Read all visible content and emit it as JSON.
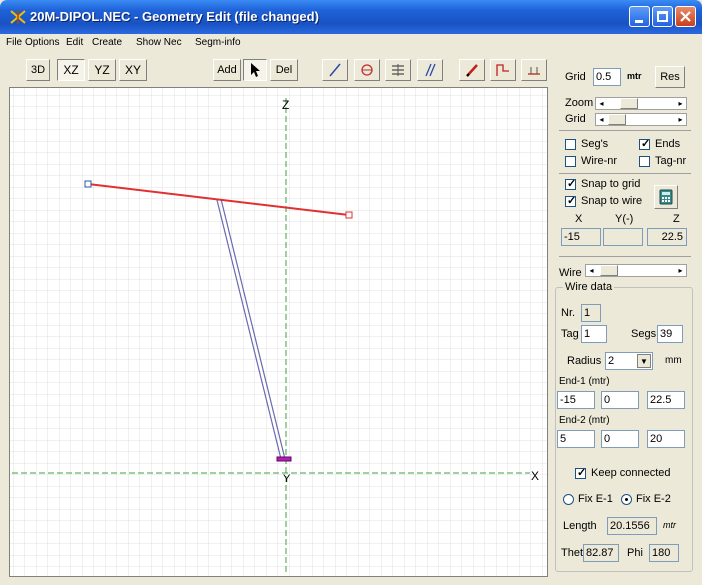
{
  "window": {
    "title": "20M-DIPOL.NEC - Geometry Edit (file changed)"
  },
  "menu": [
    "File",
    "Options",
    "Edit",
    "Create",
    "Show Nec",
    "Segm-info"
  ],
  "toolbar": {
    "view_3d": "3D",
    "view_xz": "XZ",
    "view_yz": "YZ",
    "view_xy": "XY",
    "add": "Add",
    "del": "Del"
  },
  "canvas": {
    "axis_z": "Z",
    "axis_x": "X",
    "axis_y": "Y"
  },
  "panel": {
    "grid_label": "Grid",
    "grid_value": "0.5",
    "grid_unit": "mtr",
    "res_button": "Res",
    "zoom_label": "Zoom",
    "grid_slider_label": "Grid",
    "segs_label": "Seg's",
    "ends_label": "Ends",
    "wirenr_label": "Wire-nr",
    "tagnr_label": "Tag-nr",
    "snap_grid_label": "Snap to grid",
    "snap_wire_label": "Snap to wire",
    "x_label": "X",
    "y_label": "Y(-)",
    "z_label": "Z",
    "x_value": "-15",
    "y_value": "",
    "z_value": "22.5",
    "wire_label": "Wire",
    "wire_data_label": "Wire data",
    "nr_label": "Nr.",
    "nr_value": "1",
    "tag_label": "Tag",
    "tag_value": "1",
    "segs_count_label": "Segs",
    "segs_value": "39",
    "radius_label": "Radius",
    "radius_value": "2",
    "radius_unit": "mm",
    "end1_label": "End-1 (mtr)",
    "end1": [
      "-15",
      "0",
      "22.5"
    ],
    "end2_label": "End-2 (mtr)",
    "end2": [
      "5",
      "0",
      "20"
    ],
    "keep_connected_label": "Keep connected",
    "fix_e1_label": "Fix E-1",
    "fix_e2_label": "Fix E-2",
    "length_label": "Length",
    "length_value": "20.1556",
    "length_unit": "mtr",
    "theta_label": "Thet",
    "theta_value": "82.87",
    "phi_label": "Phi",
    "phi_value": "180"
  },
  "state": {
    "segs_checked": false,
    "ends_checked": true,
    "wirenr_checked": false,
    "tagnr_checked": false,
    "snap_grid_checked": true,
    "snap_wire_checked": true,
    "keep_connected_checked": true,
    "fix_selected": "Fix E-2"
  },
  "colors": {
    "titlebar": "#1f62d8",
    "wire": "#e03030",
    "feedline": "#6a6ab0",
    "axis": "#40a040",
    "grid": "#dcdcdc"
  }
}
